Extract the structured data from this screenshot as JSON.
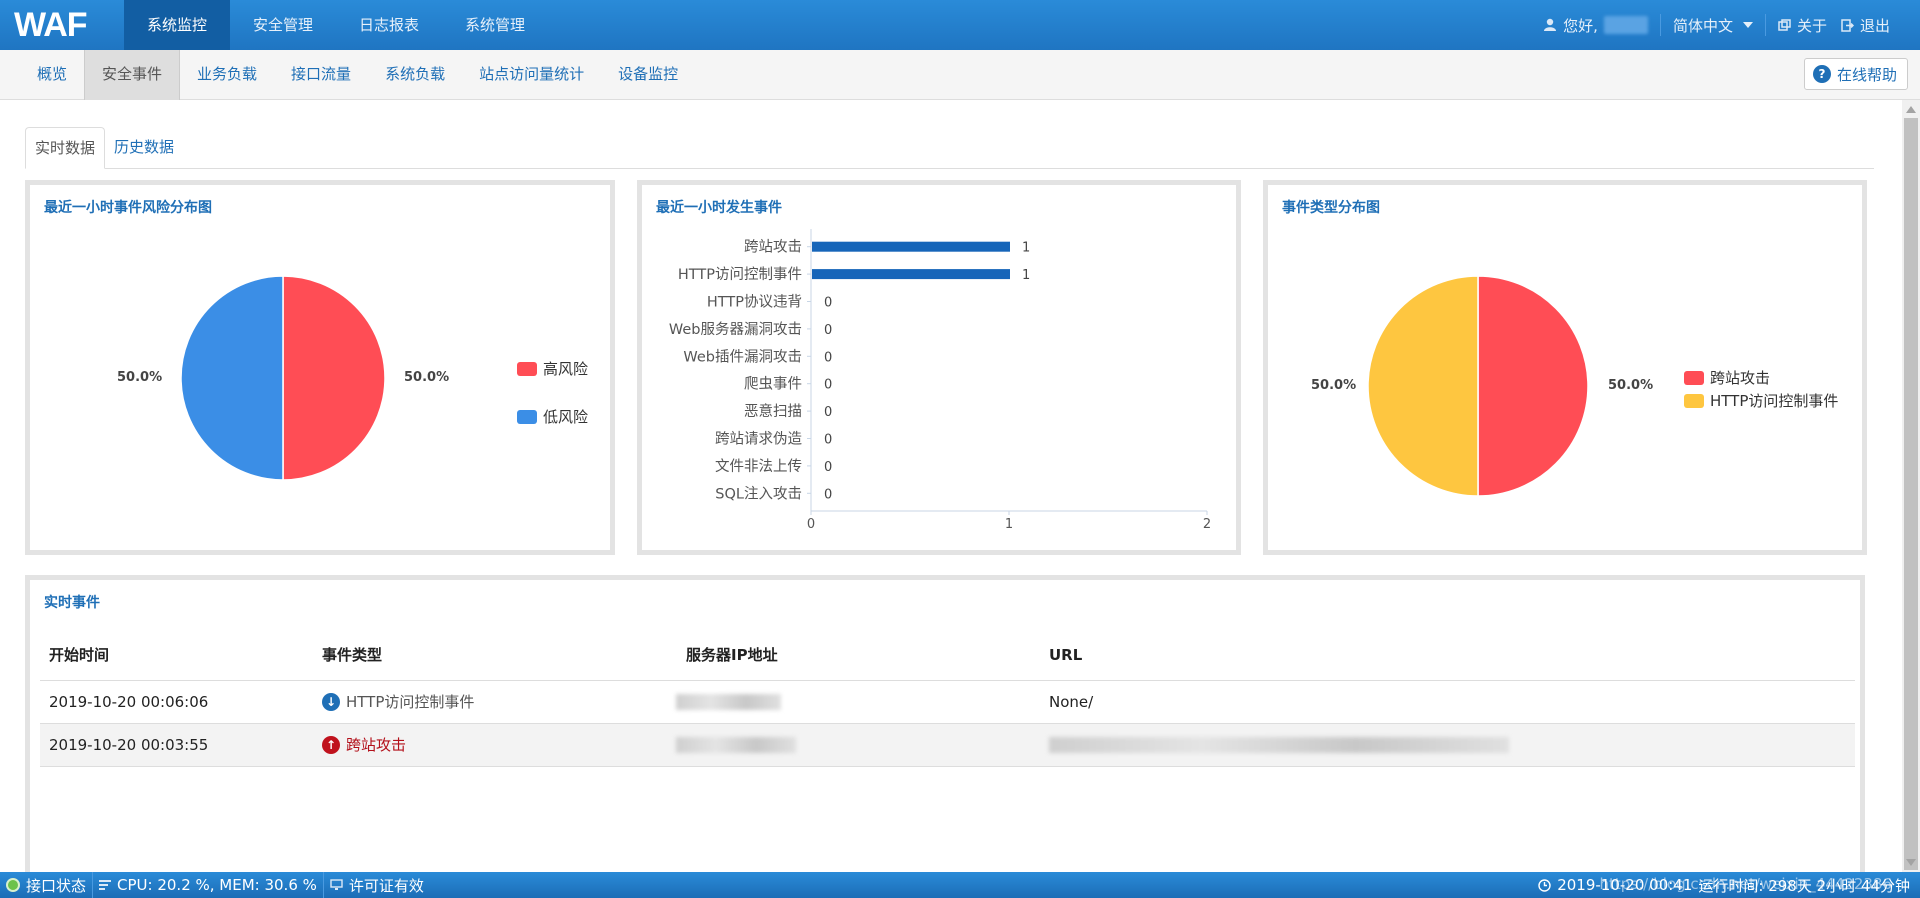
{
  "app": {
    "logo": "WAF"
  },
  "topnav": {
    "items": [
      "系统监控",
      "安全管理",
      "日志报表",
      "系统管理"
    ],
    "greeting": "您好,",
    "language": "简体中文",
    "about": "关于",
    "logout": "退出"
  },
  "subnav": {
    "items": [
      "概览",
      "安全事件",
      "业务负载",
      "接口流量",
      "系统负载",
      "站点访问量统计",
      "设备监控"
    ],
    "help": "在线帮助"
  },
  "tabs": [
    "实时数据",
    "历史数据"
  ],
  "panels": {
    "risk": {
      "title": "最近一小时事件风险分布图",
      "legend": [
        "高风险",
        "低风险"
      ],
      "pct_left": "50.0%",
      "pct_right": "50.0%"
    },
    "events": {
      "title": "最近一小时发生事件"
    },
    "types": {
      "title": "事件类型分布图",
      "legend": [
        "跨站攻击",
        "HTTP访问控制事件"
      ],
      "pct_left": "50.0%",
      "pct_right": "50.0%"
    },
    "realtime": {
      "title": "实时事件"
    }
  },
  "colors": {
    "high": "#ff4d55",
    "low": "#3b8ee6",
    "yellow": "#fec640",
    "bar": "#1665b9"
  },
  "chart_data": [
    {
      "type": "pie",
      "title": "最近一小时事件风险分布图",
      "slices": [
        {
          "label": "高风险",
          "value": 50.0
        },
        {
          "label": "低风险",
          "value": 50.0
        }
      ]
    },
    {
      "type": "bar",
      "title": "最近一小时发生事件",
      "orientation": "horizontal",
      "categories": [
        "跨站攻击",
        "HTTP访问控制事件",
        "HTTP协议违背",
        "Web服务器漏洞攻击",
        "Web插件漏洞攻击",
        "爬虫事件",
        "恶意扫描",
        "跨站请求伪造",
        "文件非法上传",
        "SQL注入攻击"
      ],
      "values": [
        1,
        1,
        0,
        0,
        0,
        0,
        0,
        0,
        0,
        0
      ],
      "xlim": [
        0,
        2
      ],
      "xticks": [
        "0",
        "1",
        "2"
      ]
    },
    {
      "type": "pie",
      "title": "事件类型分布图",
      "slices": [
        {
          "label": "跨站攻击",
          "value": 50.0
        },
        {
          "label": "HTTP访问控制事件",
          "value": 50.0
        }
      ]
    }
  ],
  "table": {
    "headers": [
      "开始时间",
      "事件类型",
      "服务器IP地址",
      "URL"
    ],
    "rows": [
      {
        "time": "2019-10-20 00:06:06",
        "type": "HTTP访问控制事件",
        "url": "None/"
      },
      {
        "time": "2019-10-20 00:03:55",
        "type": "跨站攻击",
        "url": ""
      }
    ]
  },
  "statusbar": {
    "iface": "接口状态",
    "cpu": "CPU:  20.2 %, MEM:  30.6 %",
    "license": "许可证有效",
    "datetime": "2019-10-20 00:41",
    "uptime": "运行时间: 298天 2小时 44分钟",
    "watermark": "https://blog.csdn.net/weixin_44422386"
  }
}
